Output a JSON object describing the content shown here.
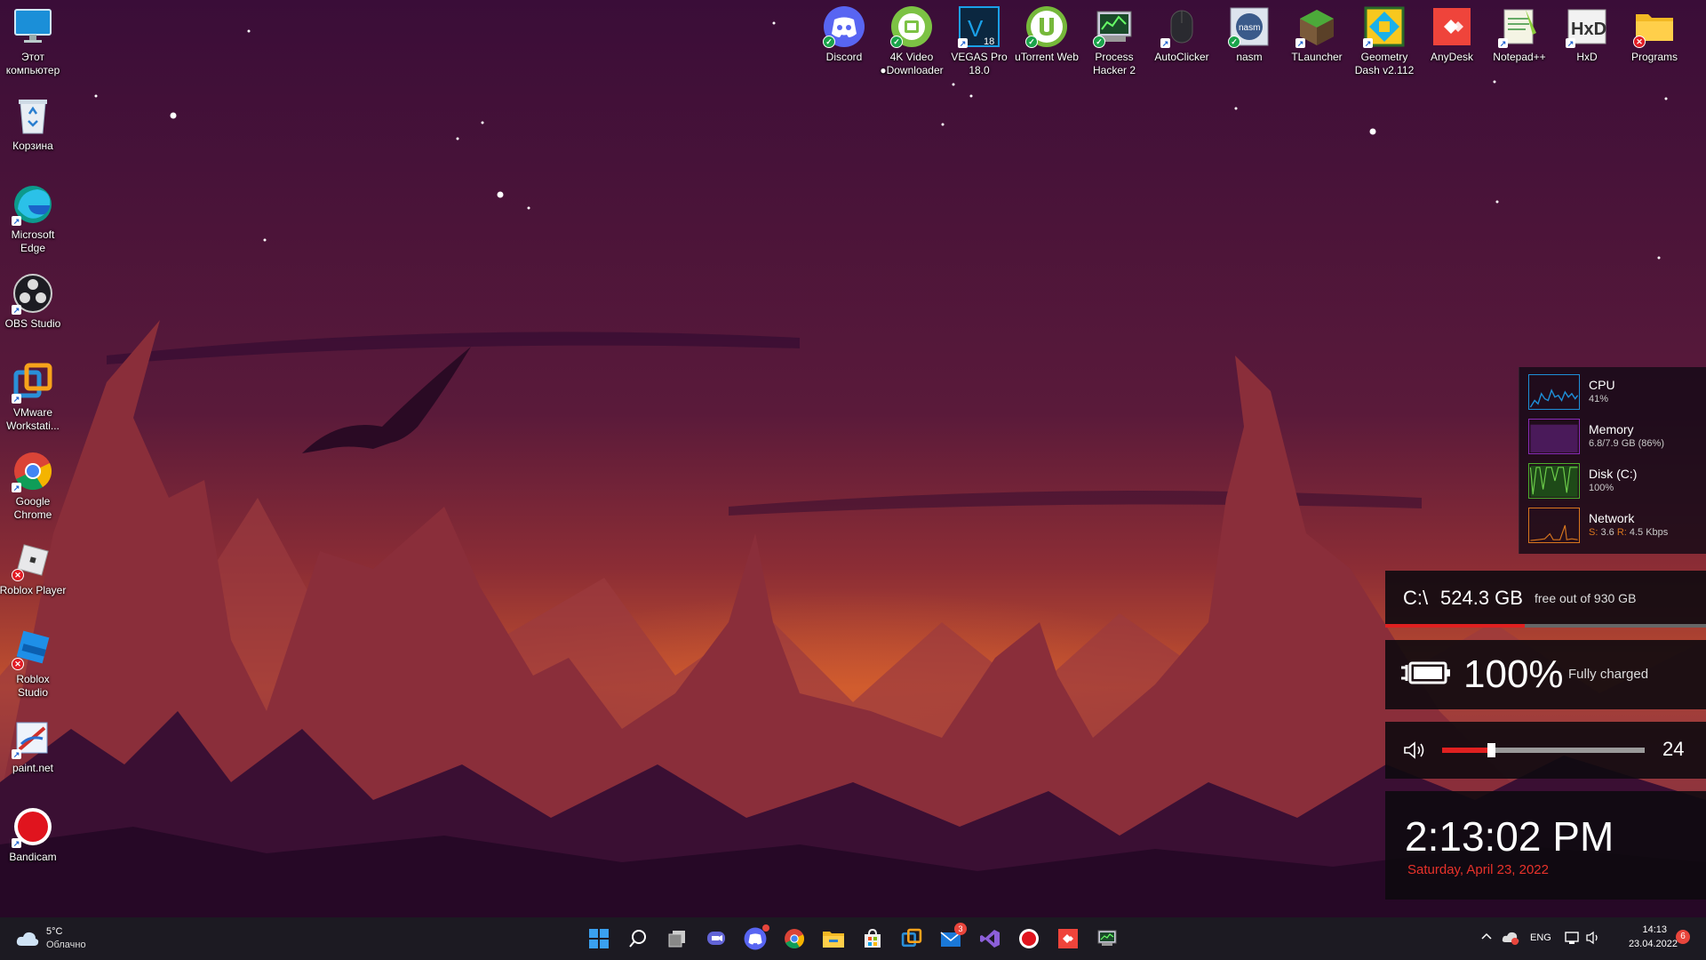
{
  "desktop": {
    "left_icons": [
      {
        "label": "Этот\nкомпьютер",
        "icon": "monitor-icon"
      },
      {
        "label": "Корзина",
        "icon": "recycle-bin-icon"
      },
      {
        "label": "Microsoft\nEdge",
        "icon": "edge-icon"
      },
      {
        "label": "OBS Studio",
        "icon": "obs-icon"
      },
      {
        "label": "VMware\nWorkstati...",
        "icon": "vmware-icon"
      },
      {
        "label": "Google\nChrome",
        "icon": "chrome-icon"
      },
      {
        "label": "Roblox Player",
        "icon": "roblox-player-icon"
      },
      {
        "label": "Roblox\nStudio",
        "icon": "roblox-studio-icon"
      },
      {
        "label": "paint.net",
        "icon": "paintnet-icon"
      },
      {
        "label": "Bandicam",
        "icon": "bandicam-icon"
      }
    ],
    "top_icons": [
      {
        "label": "Discord",
        "icon": "discord-icon"
      },
      {
        "label": "4K Video\n●Downloader",
        "icon": "4k-downloader-icon"
      },
      {
        "label": "VEGAS Pro\n18.0",
        "icon": "vegas-icon",
        "badge": "18"
      },
      {
        "label": "uTorrent Web",
        "icon": "utorrent-icon"
      },
      {
        "label": "Process\nHacker 2",
        "icon": "process-hacker-icon"
      },
      {
        "label": "AutoClicker",
        "icon": "mouse-icon"
      },
      {
        "label": "nasm",
        "icon": "nasm-icon",
        "badge": "nasm"
      },
      {
        "label": "TLauncher",
        "icon": "tlauncher-icon"
      },
      {
        "label": "Geometry\nDash v2.112",
        "icon": "geometry-dash-icon"
      },
      {
        "label": "AnyDesk",
        "icon": "anydesk-icon"
      },
      {
        "label": "Notepad++",
        "icon": "notepadpp-icon"
      },
      {
        "label": "HxD",
        "icon": "hxd-icon",
        "badge": "HxD"
      },
      {
        "label": "Programs",
        "icon": "folder-icon"
      }
    ]
  },
  "perf": {
    "cpu": {
      "name": "CPU",
      "value": "41%",
      "color": "#1e8fd8"
    },
    "memory": {
      "name": "Memory",
      "value": "6.8/7.9 GB (86%)",
      "color": "#8a2cb8"
    },
    "disk": {
      "name": "Disk (C:)",
      "value": "100%",
      "color": "#4caf2c"
    },
    "network": {
      "name": "Network",
      "value_s_label": "S:",
      "value_s": " 3.6 ",
      "value_r_label": "R:",
      "value_r": " 4.5 Kbps",
      "color": "#d8761e"
    }
  },
  "disk_widget": {
    "drive": "C:\\",
    "free": "524.3 GB",
    "suffix": "free out of 930 GB",
    "used_fraction": 0.436
  },
  "battery_widget": {
    "percent": "100%",
    "status": "Fully charged"
  },
  "volume_widget": {
    "level": "24",
    "fraction": 0.24
  },
  "clock_widget": {
    "time": "2:13:02 PM",
    "date": "Saturday, April 23, 2022"
  },
  "taskbar": {
    "weather_temp": "5°C",
    "weather_desc": "Облачно",
    "apps": [
      "start-icon",
      "search-icon",
      "task-view-icon",
      "teams-chat-icon",
      "discord-icon",
      "chrome-icon",
      "file-explorer-icon",
      "store-icon",
      "vmware-icon",
      "mail-icon",
      "visual-studio-icon",
      "bandicam-icon",
      "anydesk-icon",
      "process-hacker-icon"
    ],
    "mail_badge": "3",
    "lang": "ENG",
    "tray_time": "14:13",
    "tray_date": "23.04.2022",
    "notif_count": "6"
  }
}
